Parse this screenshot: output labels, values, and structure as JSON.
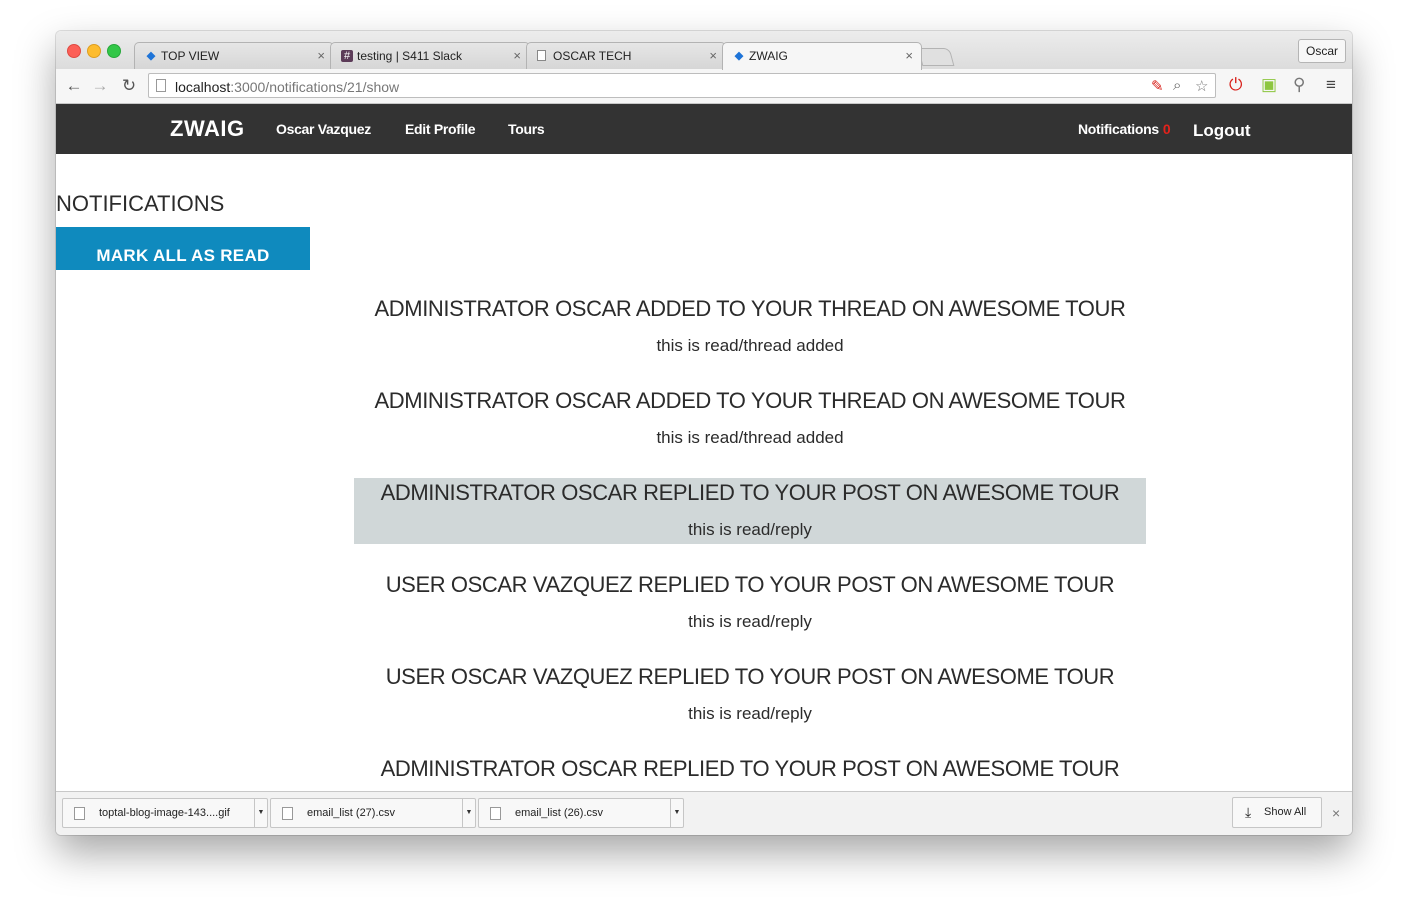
{
  "browser": {
    "tabs": [
      {
        "title": "TOP VIEW",
        "icon": "zwaig-diamond-icon"
      },
      {
        "title": "testing | S411 Slack",
        "icon": "slack-hash-icon"
      },
      {
        "title": "OSCAR TECH",
        "icon": "document-icon"
      },
      {
        "title": "ZWAIG",
        "icon": "zwaig-diamond-icon",
        "active": true
      }
    ],
    "tab_close_glyph": "×",
    "profile_name": "Oscar",
    "url_host": "localhost",
    "url_rest": ":3000/notifications/21/show"
  },
  "navbar": {
    "brand": "ZWAIG",
    "links": [
      "Oscar Vazquez",
      "Edit Profile",
      "Tours"
    ],
    "notifications_label": "Notifications",
    "notifications_count": "0",
    "logout_label": "Logout",
    "background_color": "#333333",
    "count_color": "#e4221b"
  },
  "page": {
    "title": "NOTIFICATIONS",
    "mark_all_label": "MARK ALL AS READ",
    "button_color": "#0f8abe"
  },
  "notifications": [
    {
      "title": "ADMINISTRATOR OSCAR ADDED TO YOUR THREAD ON AWESOME TOUR",
      "body": "this is read/thread added",
      "unread": false
    },
    {
      "title": "ADMINISTRATOR OSCAR ADDED TO YOUR THREAD ON AWESOME TOUR",
      "body": "this is read/thread added",
      "unread": false
    },
    {
      "title": "ADMINISTRATOR OSCAR REPLIED TO YOUR POST ON AWESOME TOUR",
      "body": "this is read/reply",
      "unread": true
    },
    {
      "title": "USER OSCAR VAZQUEZ REPLIED TO YOUR POST ON AWESOME TOUR",
      "body": "this is read/reply",
      "unread": false
    },
    {
      "title": "USER OSCAR VAZQUEZ REPLIED TO YOUR POST ON AWESOME TOUR",
      "body": "this is read/reply",
      "unread": false
    },
    {
      "title": "ADMINISTRATOR OSCAR REPLIED TO YOUR POST ON AWESOME TOUR",
      "body": "",
      "unread": false
    }
  ],
  "downloads": {
    "items": [
      "toptal-blog-image-143....gif",
      "email_list (27).csv",
      "email_list (26).csv"
    ],
    "show_all_label": "Show All"
  }
}
